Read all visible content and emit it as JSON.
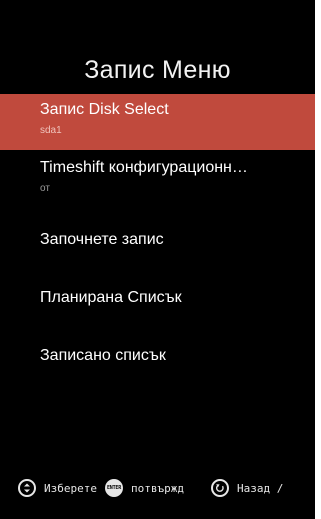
{
  "menu_title": "Запис Меню",
  "items": [
    {
      "label": "Запис Disk Select",
      "sub": "sda1"
    },
    {
      "label": "Timeshift конфигурационн…",
      "sub": "от"
    },
    {
      "label": "Започнете запис"
    },
    {
      "label": "Планирана Списък"
    },
    {
      "label": "Записано списък"
    }
  ],
  "footer": {
    "select_label": "Изберете",
    "enter_icon_text": "ENTER",
    "confirm_label": "потвържд",
    "back_label": "Назад /"
  },
  "colors": {
    "background": "#000000",
    "selected_row": "#c04a3d"
  }
}
